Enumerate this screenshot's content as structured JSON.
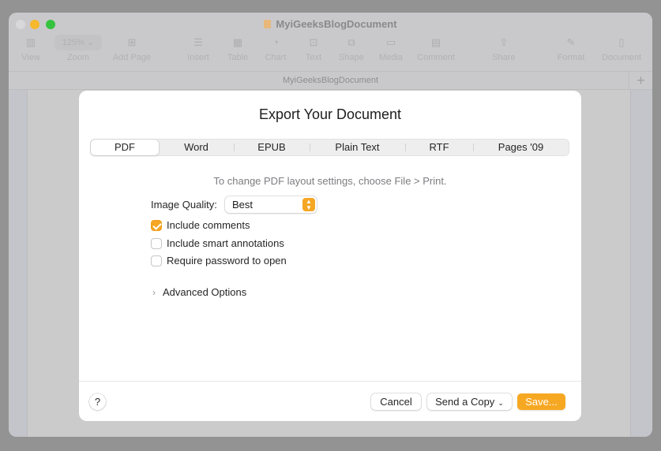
{
  "window": {
    "title": "MyiGeeksBlogDocument",
    "tab_title": "MyiGeeksBlogDocument",
    "toolbar": [
      {
        "label": "View",
        "icon": "sidebar-icon"
      },
      {
        "label": "Zoom",
        "icon": "zoom-popup",
        "value": "125%"
      },
      {
        "label": "Add Page",
        "icon": "add-page-icon"
      },
      {
        "label": "Insert",
        "icon": "insert-icon"
      },
      {
        "label": "Table",
        "icon": "table-icon"
      },
      {
        "label": "Chart",
        "icon": "chart-icon"
      },
      {
        "label": "Text",
        "icon": "text-icon"
      },
      {
        "label": "Shape",
        "icon": "shape-icon"
      },
      {
        "label": "Media",
        "icon": "media-icon"
      },
      {
        "label": "Comment",
        "icon": "comment-icon"
      },
      {
        "label": "Share",
        "icon": "share-icon"
      },
      {
        "label": "Format",
        "icon": "format-icon"
      },
      {
        "label": "Document",
        "icon": "document-icon"
      }
    ],
    "add_tab_label": "+"
  },
  "dialog": {
    "title": "Export Your Document",
    "formats": [
      "PDF",
      "Word",
      "EPUB",
      "Plain Text",
      "RTF",
      "Pages '09"
    ],
    "selected_format": "PDF",
    "hint": "To change PDF layout settings, choose File > Print.",
    "image_quality": {
      "label": "Image Quality:",
      "value": "Best"
    },
    "options": [
      {
        "label": "Include comments",
        "checked": true
      },
      {
        "label": "Include smart annotations",
        "checked": false
      },
      {
        "label": "Require password to open",
        "checked": false
      }
    ],
    "advanced_label": "Advanced Options",
    "help_label": "?",
    "buttons": {
      "cancel": "Cancel",
      "send_copy": "Send a Copy",
      "save": "Save..."
    }
  },
  "colors": {
    "accent": "#f5a623"
  }
}
